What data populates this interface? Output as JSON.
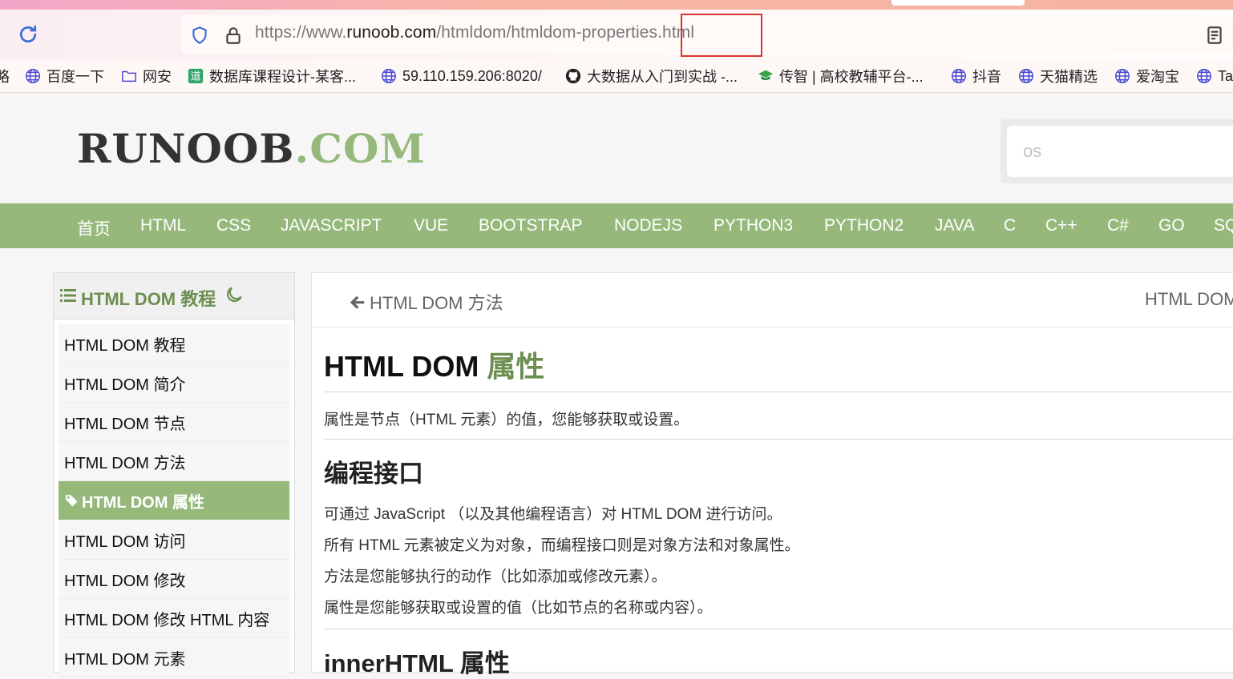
{
  "browser": {
    "url_prefix": "https://www.",
    "url_host": "runoob.com",
    "url_path": "/htmldom/htmldom-properties.html",
    "bookmarks": [
      {
        "label": "略",
        "icon": "text-fragment"
      },
      {
        "label": "百度一下",
        "icon": "globe-icon"
      },
      {
        "label": "网安",
        "icon": "folder-icon"
      },
      {
        "label": "数据库课程设计-某客...",
        "icon": "site-icon"
      },
      {
        "label": "59.110.159.206:8020/",
        "icon": "globe-icon"
      },
      {
        "label": "大数据从入门到实战 -...",
        "icon": "github-icon"
      },
      {
        "label": "传智 | 高校教辅平台-...",
        "icon": "cap-icon"
      },
      {
        "label": "抖音",
        "icon": "globe-icon"
      },
      {
        "label": "天猫精选",
        "icon": "globe-icon"
      },
      {
        "label": "爱淘宝",
        "icon": "globe-icon"
      },
      {
        "label": "Ta",
        "icon": "globe-icon"
      }
    ]
  },
  "header": {
    "logo_main": "RUNOOB",
    "logo_dot": ".COM",
    "search_placeholder": "os"
  },
  "nav": [
    "首页",
    "HTML",
    "CSS",
    "JAVASCRIPT",
    "VUE",
    "BOOTSTRAP",
    "NODEJS",
    "PYTHON3",
    "PYTHON2",
    "JAVA",
    "C",
    "C++",
    "C#",
    "GO",
    "SQ"
  ],
  "sidebar": {
    "title": "HTML DOM 教程",
    "items": [
      "HTML DOM 教程",
      "HTML DOM 简介",
      "HTML DOM 节点",
      "HTML DOM 方法",
      "HTML DOM 属性",
      "HTML DOM 访问",
      "HTML DOM 修改",
      "HTML DOM 修改 HTML 内容",
      "HTML DOM 元素"
    ],
    "active_index": 4
  },
  "content": {
    "prev_label": "HTML DOM 方法",
    "next_label": "HTML DOM",
    "title_main": "HTML DOM ",
    "title_accent": "属性",
    "intro": "属性是节点（HTML 元素）的值，您能够获取或设置。",
    "section_title": "编程接口",
    "paragraphs": [
      "可通过 JavaScript （以及其他编程语言）对 HTML DOM 进行访问。",
      "所有 HTML 元素被定义为对象，而编程接口则是对象方法和对象属性。",
      "方法是您能够执行的动作（比如添加或修改元素）。",
      "属性是您能够获取或设置的值（比如节点的名称或内容）。"
    ],
    "next_section_partial": "innerHTML 属性"
  },
  "colors": {
    "accent": "#96b97b",
    "accent_dark": "#6c8f4f"
  }
}
